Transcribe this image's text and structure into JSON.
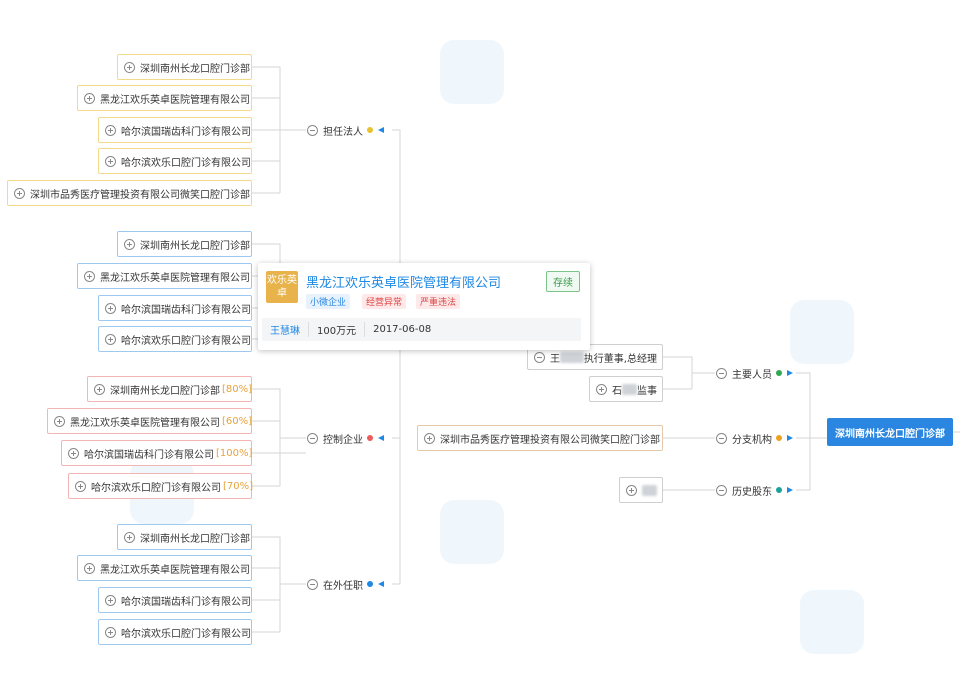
{
  "root": {
    "label": "深圳南州长龙口腔门诊部"
  },
  "popup": {
    "logo": "欢乐英卓",
    "name": "黑龙江欢乐英卓医院管理有限公司",
    "status": "存续",
    "tags": [
      "小微企业",
      "经营异常",
      "严重违法"
    ],
    "person": "王慧琳",
    "capital": "100万元",
    "date": "2017-06-08"
  },
  "categories": {
    "legal_rep": {
      "label": "担任法人",
      "color": "#e8c12c"
    },
    "controlled": {
      "label": "控制企业",
      "color": "#ee5b5b"
    },
    "external": {
      "label": "在外任职",
      "color": "#1e88e5"
    },
    "key_people": {
      "label": "主要人员",
      "color": "#2fa84f"
    },
    "branches": {
      "label": "分支机构",
      "color": "#f0a020"
    },
    "history": {
      "label": "历史股东",
      "color": "#1aa39a"
    }
  },
  "legal_rep_nodes": [
    "深圳南州长龙口腔门诊部",
    "黑龙江欢乐英卓医院管理有限公司",
    "哈尔滨国瑞齿科门诊有限公司",
    "哈尔滨欢乐口腔门诊有限公司",
    "深圳市品秀医疗管理投资有限公司微笑口腔门诊部"
  ],
  "middle_nodes": [
    "深圳南州长龙口腔门诊部",
    "黑龙江欢乐英卓医院管理有限公司",
    "哈尔滨国瑞齿科门诊有限公司",
    "哈尔滨欢乐口腔门诊有限公司"
  ],
  "controlled_nodes": [
    {
      "name": "深圳南州长龙口腔门诊部",
      "pct": "[80%]"
    },
    {
      "name": "黑龙江欢乐英卓医院管理有限公司",
      "pct": "[60%]"
    },
    {
      "name": "哈尔滨国瑞齿科门诊有限公司",
      "pct": "[100%]"
    },
    {
      "name": "哈尔滨欢乐口腔门诊有限公司",
      "pct": "[70%]"
    }
  ],
  "external_nodes": [
    "深圳南州长龙口腔门诊部",
    "黑龙江欢乐英卓医院管理有限公司",
    "哈尔滨国瑞齿科门诊有限公司",
    "哈尔滨欢乐口腔门诊有限公司"
  ],
  "key_people_nodes": [
    {
      "prefix": "王",
      "role": "执行董事,总经理"
    },
    {
      "prefix": "石",
      "role": "监事"
    }
  ],
  "branch_nodes": [
    "深圳市品秀医疗管理投资有限公司微笑口腔门诊部"
  ]
}
